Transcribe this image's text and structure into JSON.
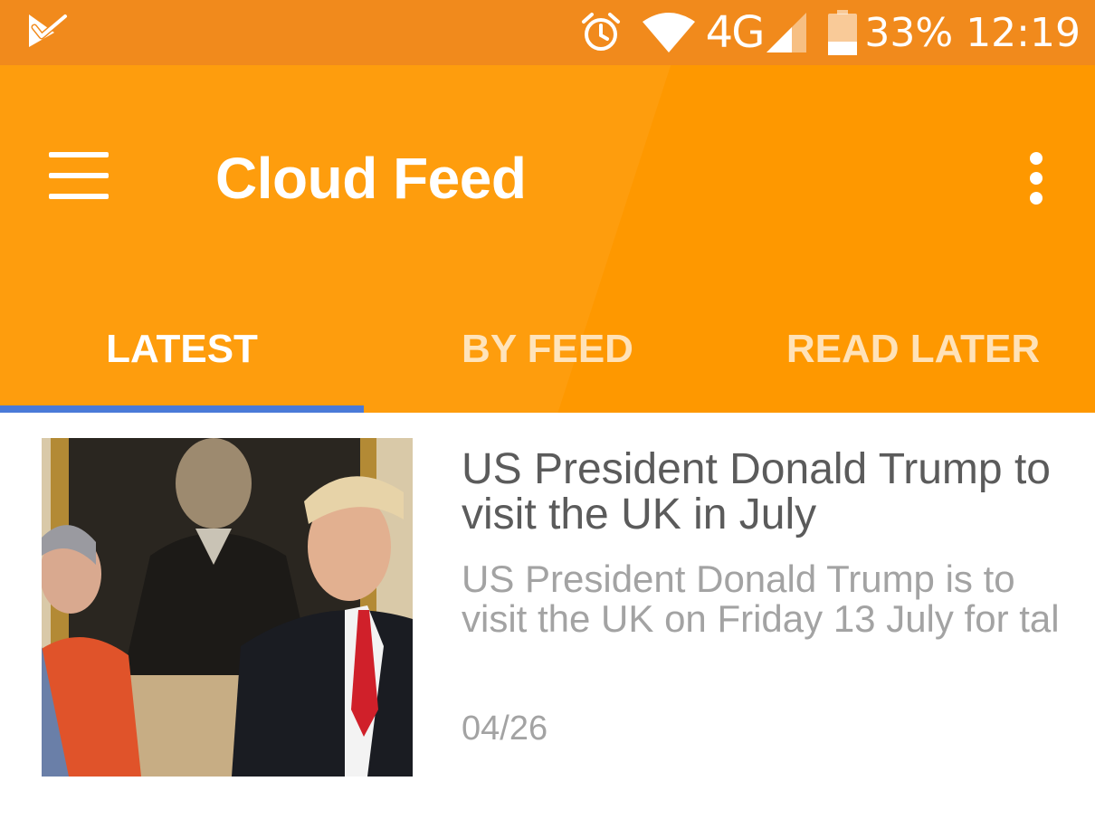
{
  "status_bar": {
    "network": "4G",
    "battery_percent": "33%",
    "time": "12:19",
    "battery_level": 0.33,
    "icons": [
      "notification-check-icon",
      "alarm-icon",
      "wifi-icon",
      "signal-icon",
      "battery-icon"
    ]
  },
  "app_bar": {
    "title": "Cloud Feed",
    "background_color": "#fe9800",
    "status_color": "#f18a1c",
    "icons": [
      "menu-icon",
      "more-vert-icon"
    ]
  },
  "tabs": [
    {
      "label": "LATEST",
      "active": true
    },
    {
      "label": "BY FEED",
      "active": false
    },
    {
      "label": "READ LATER",
      "active": false
    }
  ],
  "tab_indicator_color": "#4a7ad8",
  "articles": [
    {
      "headline": "US President Donald Trump to visit the UK in July",
      "summary": "US President Donald Trump is to visit the UK on Friday 13 July for tal",
      "date": "04/26"
    }
  ]
}
